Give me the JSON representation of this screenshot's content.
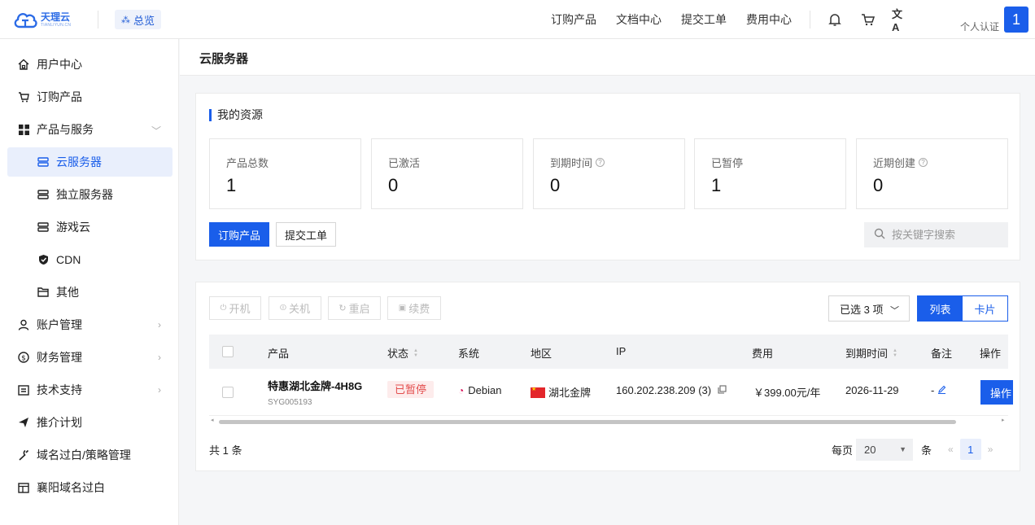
{
  "header": {
    "logo_main": "天理云",
    "logo_sub": "TIANLIYUN.CN",
    "overview_label": "总览",
    "nav": [
      "订购产品",
      "文档中心",
      "提交工单",
      "费用中心"
    ],
    "verify_label": "个人认证",
    "avatar_label": "1"
  },
  "sidebar": {
    "items": [
      {
        "label": "用户中心",
        "icon": "home-icon"
      },
      {
        "label": "订购产品",
        "icon": "cart-icon"
      },
      {
        "label": "产品与服务",
        "icon": "grid-icon"
      },
      {
        "label": "云服务器",
        "icon": "server-icon"
      },
      {
        "label": "独立服务器",
        "icon": "server-icon"
      },
      {
        "label": "游戏云",
        "icon": "server-icon"
      },
      {
        "label": "CDN",
        "icon": "shield-icon"
      },
      {
        "label": "其他",
        "icon": "folder-icon"
      },
      {
        "label": "账户管理",
        "icon": "user-icon"
      },
      {
        "label": "财务管理",
        "icon": "money-icon"
      },
      {
        "label": "技术支持",
        "icon": "support-icon"
      },
      {
        "label": "推介计划",
        "icon": "send-icon"
      },
      {
        "label": "域名过白/策略管理",
        "icon": "wrench-icon"
      },
      {
        "label": "襄阳域名过白",
        "icon": "table-icon"
      }
    ]
  },
  "page": {
    "title": "云服务器"
  },
  "resources": {
    "title": "我的资源",
    "stats": [
      {
        "label": "产品总数",
        "value": "1"
      },
      {
        "label": "已激活",
        "value": "0"
      },
      {
        "label": "到期时间",
        "value": "0"
      },
      {
        "label": "已暂停",
        "value": "1"
      },
      {
        "label": "近期创建",
        "value": "0"
      }
    ],
    "order_button": "订购产品",
    "ticket_button": "提交工单",
    "search_placeholder": "按关键字搜索"
  },
  "toolbar": {
    "actions": [
      "开机",
      "关机",
      "重启",
      "续费"
    ],
    "selected_label": "已选 3 项",
    "view_list": "列表",
    "view_card": "卡片"
  },
  "table": {
    "columns": [
      "产品",
      "状态",
      "系统",
      "地区",
      "IP",
      "费用",
      "到期时间",
      "备注",
      "操作"
    ],
    "rows": [
      {
        "product": "特惠湖北金牌-4H8G",
        "product_id": "SYG005193",
        "status": "已暂停",
        "os": "Debian",
        "region": "湖北金牌",
        "ip": "160.202.238.209 (3)",
        "fee": "￥399.00元/年",
        "expire": "2026-11-29",
        "note": "-",
        "action": "操作"
      }
    ]
  },
  "pagination": {
    "total": "共 1 条",
    "per_page_label": "每页",
    "per_page_value": "20",
    "unit": "条",
    "current_page": "1"
  },
  "colors": {
    "accent": "#1a5eea",
    "danger": "#e34d4d"
  }
}
